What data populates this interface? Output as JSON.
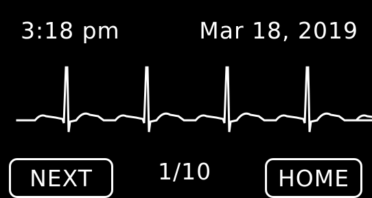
{
  "status_bar": {
    "time": "3:18 pm",
    "date": "Mar 18, 2019"
  },
  "ecg_trace": {
    "color": "#ffffff",
    "visible_beats": 5
  },
  "footer": {
    "next_label": "NEXT",
    "page_indicator": "1/10",
    "home_label": "HOME"
  }
}
